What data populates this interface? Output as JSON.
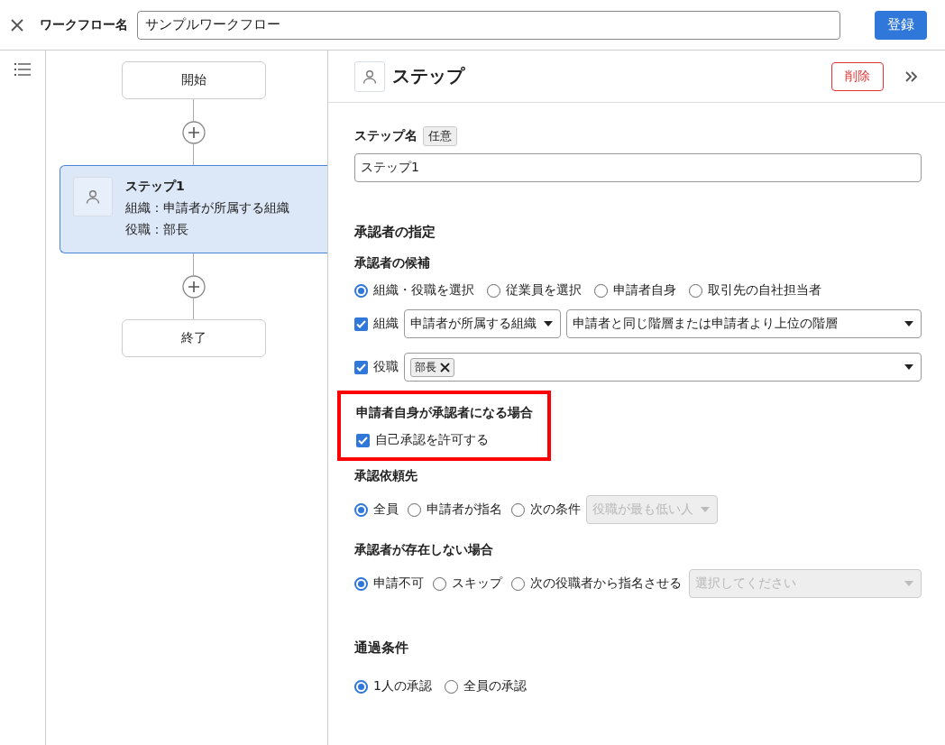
{
  "header": {
    "label": "ワークフロー名",
    "name_value": "サンプルワークフロー",
    "register_button": "登録"
  },
  "flow": {
    "start": "開始",
    "steps": [
      {
        "title": "ステップ1",
        "lines": [
          "組織：申請者が所属する組織",
          "役職：部長"
        ],
        "selected": true
      }
    ],
    "end": "終了"
  },
  "panel": {
    "title": "ステップ",
    "delete_button": "削除",
    "step_name_label": "ステップ名",
    "optional_badge": "任意",
    "step_name_value": "ステップ1",
    "approver_heading": "承認者の指定",
    "candidates": {
      "label": "承認者の候補",
      "options": [
        {
          "label": "組織・役職を選択",
          "selected": true
        },
        {
          "label": "従業員を選択",
          "selected": false
        },
        {
          "label": "申請者自身",
          "selected": false
        },
        {
          "label": "取引先の自社担当者",
          "selected": false
        }
      ],
      "org": {
        "label": "組織",
        "checked": true,
        "select_1": "申請者が所属する組織",
        "select_2": "申請者と同じ階層または申請者より上位の階層"
      },
      "role": {
        "label": "役職",
        "checked": true,
        "tags": [
          "部長"
        ]
      }
    },
    "self_approval": {
      "label": "申請者自身が承認者になる場合",
      "highlighted": true,
      "checkbox": {
        "label": "自己承認を許可する",
        "checked": true
      }
    },
    "request_to": {
      "label": "承認依頼先",
      "options": [
        {
          "label": "全員",
          "selected": true
        },
        {
          "label": "申請者が指名",
          "selected": false
        },
        {
          "label": "次の条件",
          "selected": false
        }
      ],
      "select": {
        "value": "役職が最も低い人",
        "disabled": true
      }
    },
    "no_approver": {
      "label": "承認者が存在しない場合",
      "options": [
        {
          "label": "申請不可",
          "selected": true
        },
        {
          "label": "スキップ",
          "selected": false
        },
        {
          "label": "次の役職者から指名させる",
          "selected": false
        }
      ],
      "select": {
        "placeholder": "選択してください",
        "disabled": true
      }
    },
    "pass_heading": "通過条件",
    "pass_options": [
      {
        "label": "1人の承認",
        "selected": true
      },
      {
        "label": "全員の承認",
        "selected": false
      }
    ]
  }
}
